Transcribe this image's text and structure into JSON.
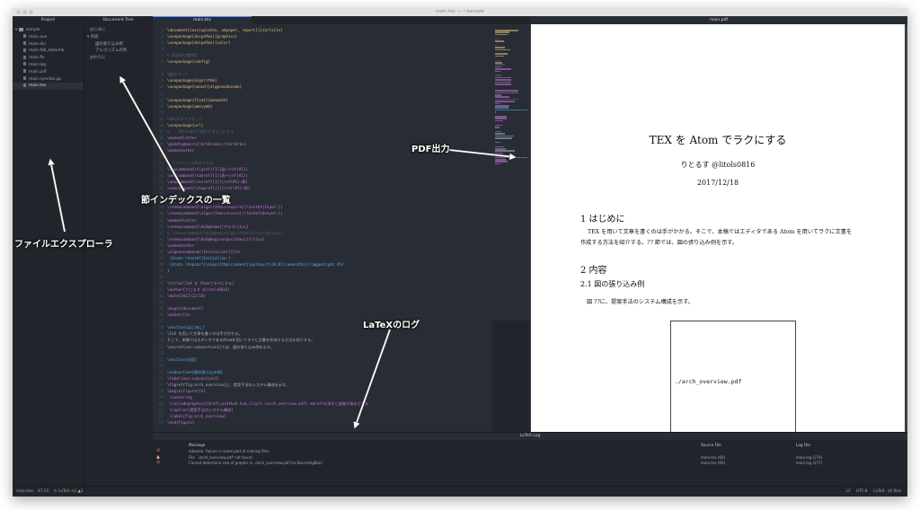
{
  "window": {
    "title": "main.tex — ~/sample",
    "accent": "#528bff"
  },
  "panels": {
    "project": "Project",
    "document_tree": "Document Tree",
    "editor_tab": "main.tex",
    "pdf_tab": "main.pdf",
    "log": "LaTeX Log"
  },
  "project_tree": {
    "folder": "sample",
    "files": [
      "main.aux",
      "main.dvi",
      "main.fdb_latexmk",
      "main.fls",
      "main.log",
      "main.pdf",
      "main.synctex.gz",
      "main.tex"
    ],
    "selected": "main.tex"
  },
  "document_tree": [
    "はじめに",
    "内容",
    "図の張り込み例",
    "アルゴリズムの例",
    "おわりに"
  ],
  "code_lines": [
    {
      "n": "1",
      "t": "\\documentclass[uplatex, a4paper, report]{jsarticle}",
      "c": "#e5c07b"
    },
    {
      "n": "2",
      "t": "\\usepackage[dvipdfmx]{graphicx}",
      "c": "#e5c07b"
    },
    {
      "n": "3",
      "t": "\\usepackage[dvipdfmx]{color}",
      "c": "#e5c07b"
    },
    {
      "n": "4",
      "t": "",
      "c": "#5c6370"
    },
    {
      "n": "5",
      "t": "% 表図の位置指定",
      "c": "#5c6370"
    },
    {
      "n": "6",
      "t": "\\usepackage{subfig}",
      "c": "#e5c07b"
    },
    {
      "n": "7",
      "t": "",
      "c": "#5c6370"
    },
    {
      "n": "8",
      "t": "%疑似コード",
      "c": "#5c6370"
    },
    {
      "n": "9",
      "t": "\\usepackage{algorithm}",
      "c": "#e5c07b"
    },
    {
      "n": "10",
      "t": "\\usepackage[noend]{algpseudocode}",
      "c": "#e5c07b"
    },
    {
      "n": "11",
      "t": "",
      "c": "#5c6370"
    },
    {
      "n": "12",
      "t": "\\usepackage{float}{amsmath}",
      "c": "#e5c07b"
    },
    {
      "n": "13",
      "t": "\\usepackage{amssymb}",
      "c": "#e5c07b"
    },
    {
      "n": "14",
      "t": "",
      "c": "#5c6370"
    },
    {
      "n": "15",
      "t": "%URLのタイプセット",
      "c": "#5c6370"
    },
    {
      "n": "16",
      "t": "\\usepackage{url}",
      "c": "#e5c07b"
    },
    {
      "n": "17",
      "t": "% -- URLの途中で改行するようにする",
      "c": "#5c6370"
    },
    {
      "n": "18",
      "t": "\\makeatletter",
      "c": "#c678dd"
    },
    {
      "n": "19",
      "t": "\\@addto@macro{\\UrlBreaks}{\\UrlOrds}",
      "c": "#c678dd"
    },
    {
      "n": "20",
      "t": "\\makeatother",
      "c": "#c678dd"
    },
    {
      "n": "21",
      "t": "",
      "c": "#5c6370"
    },
    {
      "n": "22",
      "t": "% リファレンス表示マクロ",
      "c": "#5c6370"
    },
    {
      "n": "23",
      "t": "\\newcommand{\\figref}[1]{図~\\ref{#1}}",
      "c": "#c678dd"
    },
    {
      "n": "24",
      "t": "\\newcommand{\\tabref}[1]{表~\\ref{#1}}",
      "c": "#c678dd"
    },
    {
      "n": "25",
      "t": "\\newcommand{\\secref}[1]{\\ref{#1}~節}",
      "c": "#c678dd"
    },
    {
      "n": "26",
      "t": "\\newcommand{\\chapref}[1]{\\ref{#1}~章}",
      "c": "#c678dd"
    },
    {
      "n": "27",
      "t": "",
      "c": "#5c6370"
    },
    {
      "n": "28",
      "t": "",
      "c": "#5c6370"
    },
    {
      "n": "29",
      "t": "\\renewcommand{\\algorithmicrequire}{\\textbf{Input:}}",
      "c": "#c678dd"
    },
    {
      "n": "30",
      "t": "\\renewcommand{\\algorithmicensure}{\\textbf{Output:}}",
      "c": "#c678dd"
    },
    {
      "n": "31",
      "t": "\\makeatletter",
      "c": "#c678dd"
    },
    {
      "n": "32",
      "t": "\\renewcommand{\\ALG@name}{アルゴリズム}",
      "c": "#c678dd"
    },
    {
      "n": "33",
      "t": "% \\renewcommand{\\ALG@beginalgorithmic}{\\scriptsize}",
      "c": "#5c6370"
    },
    {
      "n": "34",
      "t": "\\renewcommand{\\ALG@beginalgorithmic}{\\tiny}",
      "c": "#c678dd"
    },
    {
      "n": "35",
      "t": "\\makeatother",
      "c": "#c678dd"
    },
    {
      "n": "36",
      "t": "\\algnewcommand{\\Initialize}[1]{%",
      "c": "#c678dd"
    },
    {
      "n": "37",
      "t": "  \\State \\textbf{Initialize:}",
      "c": "#61afef"
    },
    {
      "n": "38",
      "t": "  \\State \\hspace*{\\algorithmicindent}\\parbox[t]{0.8\\linewidth}{\\raggedright #1}",
      "c": "#61afef"
    },
    {
      "n": "39",
      "t": "}",
      "c": "#abb2bf"
    },
    {
      "n": "40",
      "t": "",
      "c": "#5c6370"
    },
    {
      "n": "41",
      "t": "\\title{\\TeX を Atomでラクにする}",
      "c": "#c678dd"
    },
    {
      "n": "42",
      "t": "\\author{りとるす @litols0816}",
      "c": "#c678dd"
    },
    {
      "n": "43",
      "t": "\\date{2017/12/18}",
      "c": "#c678dd"
    },
    {
      "n": "44",
      "t": "",
      "c": "#5c6370"
    },
    {
      "n": "45",
      "t": "\\begin{document}",
      "c": "#c678dd"
    },
    {
      "n": "46",
      "t": "\\maketitle",
      "c": "#c678dd"
    },
    {
      "n": "47",
      "t": "",
      "c": "#5c6370"
    },
    {
      "n": "48",
      "t": "\\section{はじめに}",
      "c": "#61afef"
    },
    {
      "n": "49",
      "t": "\\TeX を用いて文章を書くのは手がかかる。",
      "c": "#abb2bf"
    },
    {
      "n": "50",
      "t": "そこで、本稿ではエディタであるAtomを用いてラクに文書を作成する方法を紹介する。",
      "c": "#abb2bf"
    },
    {
      "n": "51",
      "t": "\\secref{sec:subsection1}では、図の張り込み例を示す。",
      "c": "#abb2bf"
    },
    {
      "n": "52",
      "t": "",
      "c": "#5c6370"
    },
    {
      "n": "53",
      "t": "\\section{内容}",
      "c": "#61afef"
    },
    {
      "n": "54",
      "t": "",
      "c": "#5c6370"
    },
    {
      "n": "55",
      "t": "\\subsection{図の張り込み例}",
      "c": "#61afef"
    },
    {
      "n": "56",
      "t": "\\label{sec:subsection1}",
      "c": "#c678dd"
    },
    {
      "n": "57",
      "t": "\\figref{fig:arch_overview}に、提案手法のシステム構成を示す。",
      "c": "#abb2bf"
    },
    {
      "n": "58",
      "t": "\\begin{figure}[h]",
      "c": "#c678dd"
    },
    {
      "n": "59",
      "t": "  \\centering",
      "c": "#c678dd"
    },
    {
      "n": "60",
      "t": "  \\includegraphics[draft,width=6.5cm,clip]{./arch_overview.pdf} %draftを消すと画像が表示される",
      "c": "#c678dd"
    },
    {
      "n": "61",
      "t": "  \\caption{提案手法のシステム構成}",
      "c": "#c678dd"
    },
    {
      "n": "62",
      "t": "  \\label{fig:arch_overview}",
      "c": "#c678dd"
    },
    {
      "n": "63",
      "t": "\\end{figure}",
      "c": "#c678dd"
    }
  ],
  "pdf": {
    "title": "TEX を Atom でラクにする",
    "author": "りとるす @litols0816",
    "date": "2017/12/18",
    "sec1": "1   はじめに",
    "para1a": "TEX を用いて文章を書くのは手がかかる。そこで、本稿ではエディタである Atom を用いてラクに文書を",
    "para1b": "作成する方法を紹介する。?? 節では、図の張り込み例を示す。",
    "sec2": "2   内容",
    "subsec": "2.1   図の張り込み例",
    "para2": "図 ??に、提案手法のシステム構成を示す。",
    "figure_label": "./arch_overview.pdf"
  },
  "log": {
    "headers": {
      "message": "Message",
      "source": "Source File",
      "logfile": "Log File"
    },
    "rows": [
      {
        "level": "error",
        "icon": "⊘",
        "color": "#e06c75",
        "message": "latexmk: Failure in some part of making files.",
        "source": "",
        "logfile": ""
      },
      {
        "level": "warning",
        "icon": "▲",
        "color": "#e5c07b",
        "message": "File `./arch_overview.pdf' not found",
        "source": "main.tex (60)",
        "logfile": "main.log (274)"
      },
      {
        "level": "error",
        "icon": "⊘",
        "color": "#e06c75",
        "message": "Cannot determine size of graphic in ./arch_overview.pdf (no BoundingBox)",
        "source": "main.tex (60)",
        "logfile": "main.log (277)"
      }
    ]
  },
  "status": {
    "file": "main.tex",
    "cursor": "47:11",
    "latex": "LaTeX",
    "errors": "2",
    "warnings": "1",
    "eol": "LF",
    "encoding": "UTF-8",
    "grammar": "LaTeX",
    "files": "0 files"
  },
  "annotations": {
    "file_explorer": "ファイルエクスプローラ",
    "section_index": "節インデックスの一覧",
    "pdf_output": "PDF出力",
    "latex_log": "LaTeXのログ"
  }
}
